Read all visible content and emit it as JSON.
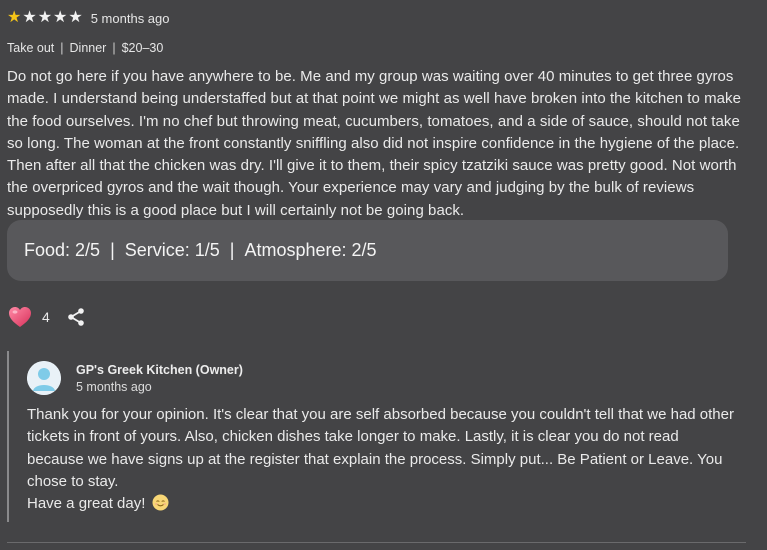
{
  "review": {
    "stars_filled": 1,
    "stars_total": 5,
    "time_ago": "5 months ago",
    "meta": [
      "Take out",
      "Dinner",
      "$20–30"
    ],
    "meta_separator": "|",
    "text": "Do not go here if you have anywhere to be. Me and my group was waiting over 40 minutes to get three gyros made. I understand being understaffed but at that point we might as well have broken into the kitchen to make the food ourselves. I'm no chef but throwing meat, cucumbers, tomatoes, and a side of sauce, should not take so long. The woman at the front constantly sniffling also did not inspire confidence in the hygiene of the place. Then after all that the chicken was dry. I'll give it to them, their spicy tzatziki sauce was pretty good. Not worth the overpriced gyros and the wait though. Your experience may vary and judging by the bulk of reviews supposedly this is a good place but I will certainly not be going back."
  },
  "ratings": {
    "food": "Food: 2/5",
    "service": "Service: 1/5",
    "atmosphere": "Atmosphere: 2/5",
    "separator": "|"
  },
  "actions": {
    "like_count": "4",
    "icons": [
      "heart-icon",
      "share-icon"
    ]
  },
  "owner_response": {
    "name": "GP's Greek Kitchen (Owner)",
    "time_ago": "5 months ago",
    "text": "Thank you for your opinion. It's clear that you are self absorbed because you couldn't tell that we had other tickets in front of yours. Also, chicken dishes take longer to make. Lastly, it is clear you do not read because we have signs up at the register that explain the process. Simply put... Be Patient or Leave. You chose to stay.",
    "closing": "Have a great day!"
  },
  "colors": {
    "background": "#444446",
    "star_filled": "#f5c518",
    "ratings_box": "#58585b",
    "heart": "#e8406a"
  }
}
